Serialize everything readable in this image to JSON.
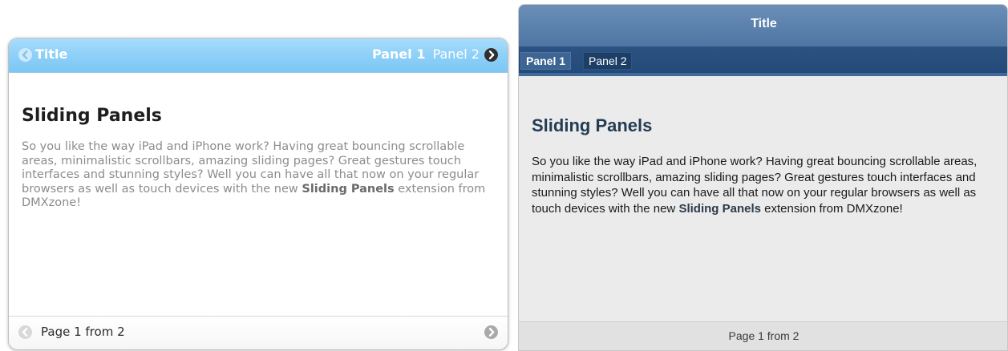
{
  "widget_left": {
    "header": {
      "back_icon": "chevron-left-circle-icon",
      "title": "Title",
      "tabs": [
        {
          "label": "Panel 1",
          "active": true
        },
        {
          "label": "Panel 2",
          "active": false
        }
      ],
      "next_icon": "chevron-right-circle-icon"
    },
    "content": {
      "heading": "Sliding Panels",
      "text_before": "So you like the way iPad and iPhone work? Having great bouncing scrollable areas, minimalistic scrollbars, amazing sliding pages? Great gestures touch interfaces and stunning styles? Well you can have all that now on your regular browsers as well as touch devices with the new ",
      "text_bold": "Sliding Panels",
      "text_after": " extension from DMXzone!"
    },
    "footer": {
      "prev_icon": "chevron-left-circle-icon",
      "page_text": "Page 1 from 2",
      "next_icon": "chevron-right-circle-icon"
    }
  },
  "widget_right": {
    "header": {
      "title": "Title",
      "tabs": [
        {
          "label": "Panel 1",
          "active": true
        },
        {
          "label": "Panel 2",
          "active": false
        }
      ]
    },
    "content": {
      "heading": "Sliding Panels",
      "text_before": "So you like the way iPad and iPhone work? Having great bouncing scrollable areas, minimalistic scrollbars, amazing sliding pages? Great gestures touch interfaces and stunning styles? Well you can have all that now on your regular browsers as well as touch devices with the new ",
      "text_bold": "Sliding Panels",
      "text_after": " extension from DMXzone!"
    },
    "footer": {
      "page_text": "Page 1 from 2"
    }
  },
  "colors": {
    "left_header": "#8ed0f8",
    "right_title_bar": "#5d83ae",
    "right_tab_bar": "#2c5282",
    "right_body": "#ebebeb"
  }
}
